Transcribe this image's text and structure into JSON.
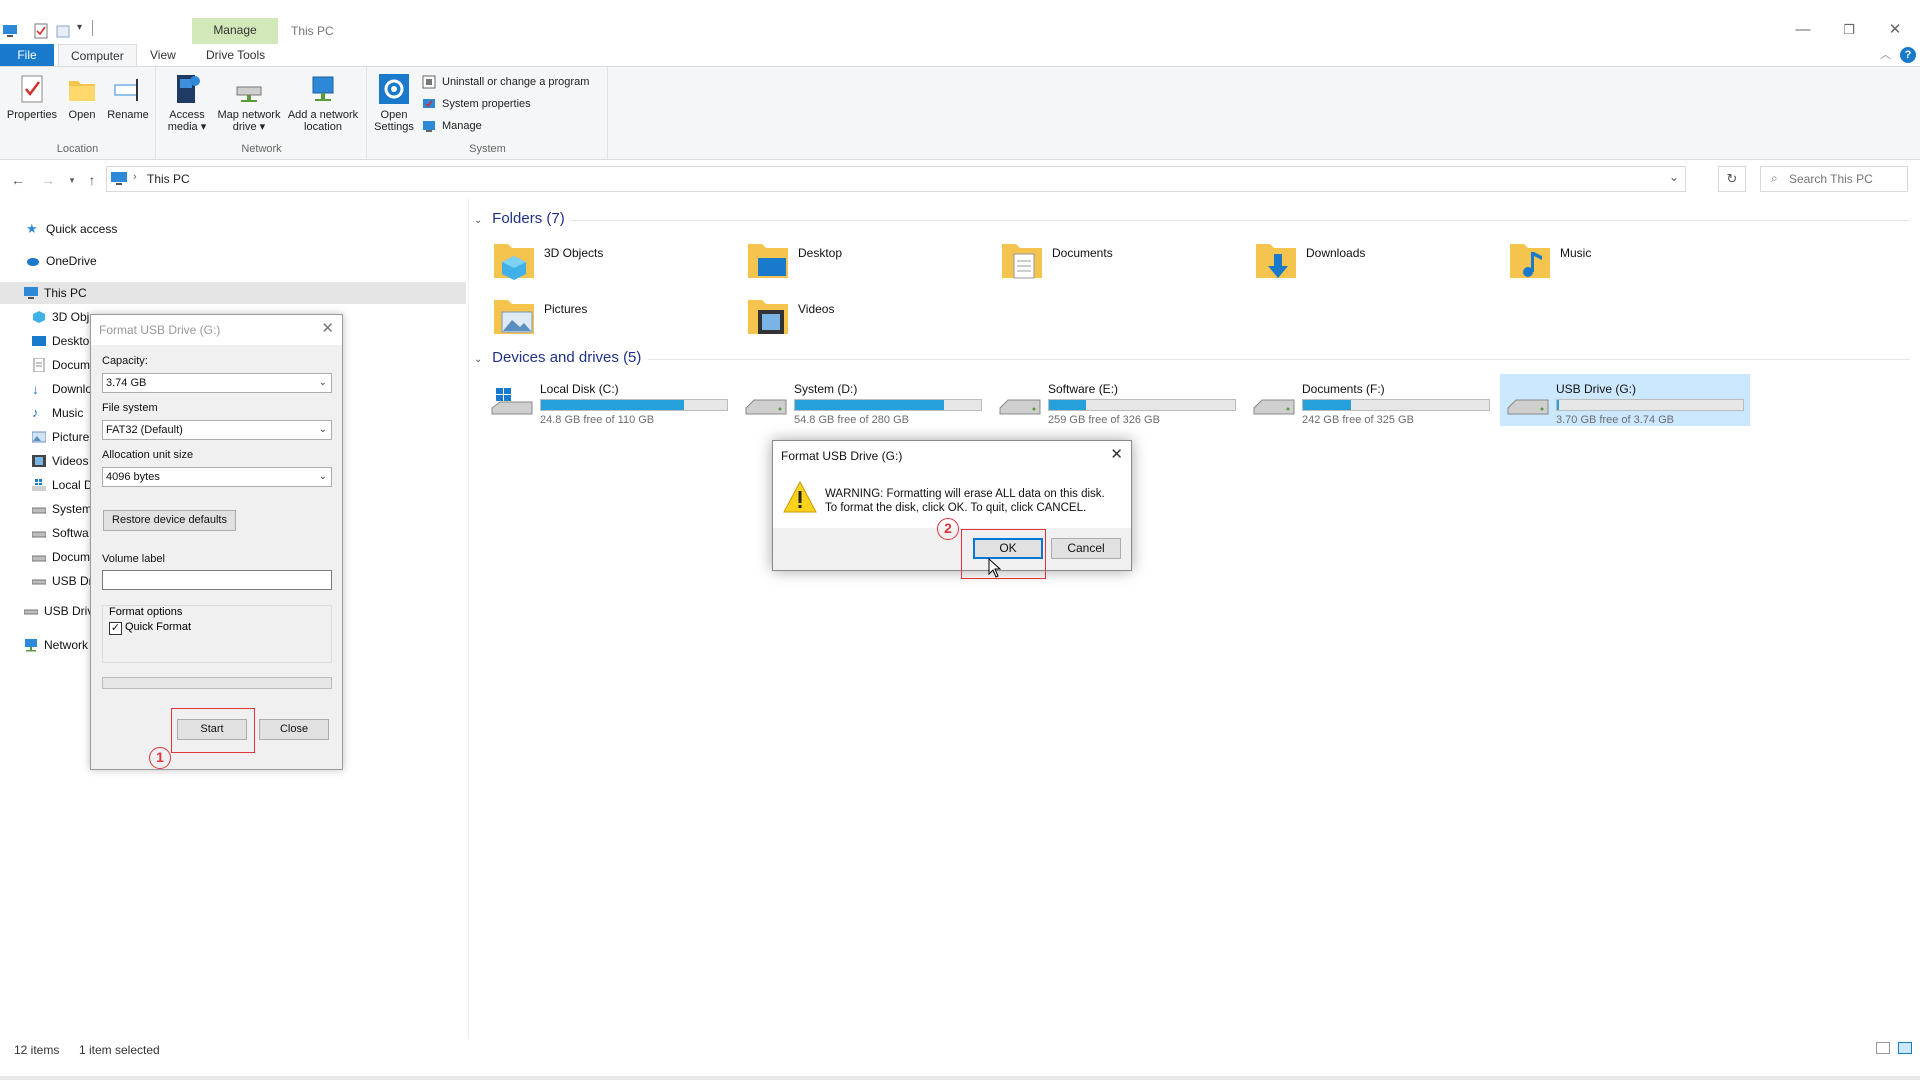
{
  "window": {
    "title": "This PC",
    "contextual_tab": "Manage",
    "controls": {
      "minimize": "—",
      "maximize": "❐",
      "close": "✕"
    }
  },
  "ribbon_tabs": [
    {
      "label": "File",
      "key": "file"
    },
    {
      "label": "Computer",
      "key": "computer",
      "active": true
    },
    {
      "label": "View",
      "key": "view"
    },
    {
      "label": "Drive Tools",
      "key": "drive_tools"
    }
  ],
  "ribbon": {
    "location_group": {
      "label": "Location",
      "properties": "Properties",
      "open": "Open",
      "rename": "Rename"
    },
    "network_group": {
      "label": "Network",
      "access_media_1": "Access",
      "access_media_2": "media ▾",
      "map_drive_1": "Map network",
      "map_drive_2": "drive ▾",
      "add_location_1": "Add a network",
      "add_location_2": "location"
    },
    "system_group": {
      "label": "System",
      "open_settings_1": "Open",
      "open_settings_2": "Settings",
      "uninstall": "Uninstall or change a program",
      "system_properties": "System properties",
      "manage": "Manage"
    }
  },
  "address": {
    "crumb": "This PC",
    "search_placeholder": "Search This PC"
  },
  "nav_pane": {
    "items": [
      {
        "label": "Quick access",
        "icon": "star-icon"
      },
      {
        "label": "OneDrive",
        "icon": "cloud-icon"
      },
      {
        "label": "This PC",
        "icon": "computer-icon"
      },
      {
        "label": "3D Obj",
        "icon": "cube-icon"
      },
      {
        "label": "Deskto",
        "icon": "desktop-icon"
      },
      {
        "label": "Docum",
        "icon": "document-icon"
      },
      {
        "label": "Downlo",
        "icon": "download-icon"
      },
      {
        "label": "Music",
        "icon": "music-icon"
      },
      {
        "label": "Picture",
        "icon": "picture-icon"
      },
      {
        "label": "Videos",
        "icon": "video-icon"
      },
      {
        "label": "Local D",
        "icon": "windows-drive-icon"
      },
      {
        "label": "System",
        "icon": "drive-icon"
      },
      {
        "label": "Softwa",
        "icon": "drive-icon"
      },
      {
        "label": "Docum",
        "icon": "drive-icon"
      },
      {
        "label": "USB Dri",
        "icon": "usb-drive-icon"
      },
      {
        "label": "USB Driv",
        "icon": "usb-drive-icon"
      },
      {
        "label": "Network",
        "icon": "network-icon"
      }
    ]
  },
  "folders": {
    "header": "Folders (7)",
    "items": [
      {
        "name": "3D Objects",
        "icon": "cube-folder-icon"
      },
      {
        "name": "Desktop",
        "icon": "desktop-folder-icon"
      },
      {
        "name": "Documents",
        "icon": "documents-folder-icon"
      },
      {
        "name": "Downloads",
        "icon": "downloads-folder-icon"
      },
      {
        "name": "Music",
        "icon": "music-folder-icon"
      },
      {
        "name": "Pictures",
        "icon": "pictures-folder-icon"
      },
      {
        "name": "Videos",
        "icon": "videos-folder-icon"
      }
    ]
  },
  "drives": {
    "header": "Devices and drives (5)",
    "items": [
      {
        "name": "Local Disk (C:)",
        "free": "24.8 GB free of 110 GB",
        "used_fraction": 0.77
      },
      {
        "name": "System (D:)",
        "free": "54.8 GB free of 280 GB",
        "used_fraction": 0.8
      },
      {
        "name": "Software (E:)",
        "free": "259 GB free of 326 GB",
        "used_fraction": 0.2
      },
      {
        "name": "Documents (F:)",
        "free": "242 GB free of 325 GB",
        "used_fraction": 0.26
      },
      {
        "name": "USB Drive (G:)",
        "free": "3.70 GB free of 3.74 GB",
        "used_fraction": 0.01,
        "selected": true
      }
    ]
  },
  "status": {
    "items": "12 items",
    "selected": "1 item selected"
  },
  "format_dialog": {
    "title": "Format USB Drive (G:)",
    "capacity_label": "Capacity:",
    "capacity_value": "3.74 GB",
    "filesystem_label": "File system",
    "filesystem_value": "FAT32 (Default)",
    "alloc_label": "Allocation unit size",
    "alloc_value": "4096 bytes",
    "restore_button": "Restore device defaults",
    "volume_label": "Volume label",
    "volume_value": "",
    "format_options_label": "Format options",
    "quick_format_label": "Quick Format",
    "quick_format_checked": true,
    "start_button": "Start",
    "close_button": "Close"
  },
  "warning_dialog": {
    "title": "Format USB Drive (G:)",
    "line1": "WARNING: Formatting will erase ALL data on this disk.",
    "line2": "To format the disk, click OK. To quit, click CANCEL.",
    "ok_button": "OK",
    "cancel_button": "Cancel",
    "close_glyph": "✕"
  },
  "annotations": {
    "step1": "1",
    "step2": "2",
    "color": "#e0333b"
  },
  "colors": {
    "file_tab": "#1979ca",
    "manage_tab": "#d3e8b9",
    "drive_bar": "#26a0da",
    "selection": "#cce8ff",
    "section_header": "#1e3287"
  }
}
